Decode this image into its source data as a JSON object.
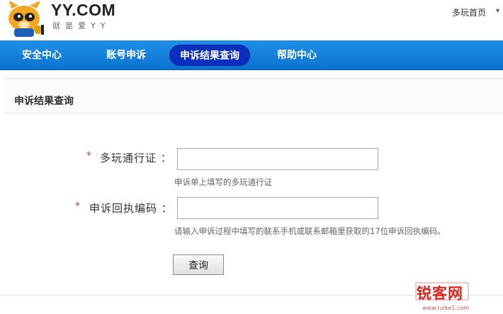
{
  "header": {
    "logo_text": "YY.COM",
    "slogan": "就是爱YY",
    "top_link": "多玩首页"
  },
  "nav": {
    "items": [
      {
        "label": "安全中心",
        "active": false
      },
      {
        "label": "账号申诉",
        "active": false
      },
      {
        "label": "申诉结果查询",
        "active": true
      },
      {
        "label": "帮助中心",
        "active": false
      }
    ]
  },
  "section": {
    "title": "申诉结果查询"
  },
  "form": {
    "required_mark": "*",
    "passport": {
      "label": "多玩通行证 ：",
      "value": "",
      "hint": "申诉单上填写的多玩通行证"
    },
    "receipt": {
      "label": "申诉回执编码 ：",
      "value": "",
      "hint": "请输入申诉过程中填写的联系手机或联系邮箱里获取的17位申诉回执编码。"
    },
    "submit_label": "查询"
  },
  "watermark": {
    "text": "锐客网",
    "url": "www.ruike1.com"
  },
  "colors": {
    "nav_bg": "#0b73cf",
    "nav_active": "#0a2fbf",
    "required": "#e4393c",
    "watermark": "#d9251c"
  }
}
